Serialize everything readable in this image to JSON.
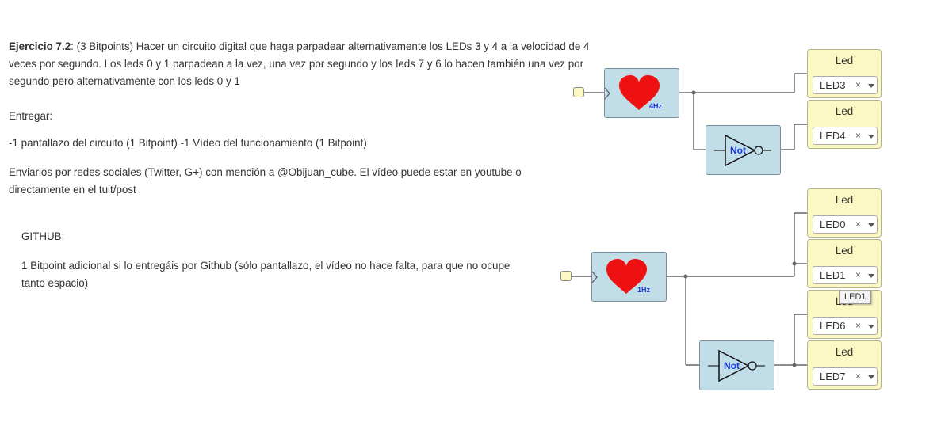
{
  "exercise": {
    "title": "Ejercicio 7.2",
    "intro": ": (3 Bitpoints) Hacer un circuito digital que haga parpadear alternativamente los LEDs 3 y 4 a la velocidad de 4 veces por segundo. Los leds 0 y 1 parpadean a la vez, una vez por segundo y los leds 7 y 6 lo hacen también una vez por segundo pero alternativamente con los leds 0 y 1",
    "entregar": "Entregar:",
    "items": "-1 pantallazo del circuito (1 Bitpoint) -1 Vídeo del funcionamiento (1 Bitpoint)",
    "enviar": "Enviarlos por redes sociales (Twitter, G+) con mención a @Obijuan_cube. El vídeo puede estar en youtube o directamente en el tuit/post",
    "github_title": "GITHUB:",
    "github_body": "1 Bitpoint adicional si lo entregáis por Github (sólo pantallazo, el vídeo no hace falta, para que no ocupe tanto espacio)"
  },
  "circuit": {
    "top": {
      "clock_freq": "4Hz",
      "not_label": "Not",
      "leds": [
        {
          "title": "Led",
          "value": "LED3",
          "clear": "×"
        },
        {
          "title": "Led",
          "value": "LED4",
          "clear": "×"
        }
      ]
    },
    "bottom": {
      "clock_freq": "1Hz",
      "not_label": "Not",
      "leds": [
        {
          "title": "Led",
          "value": "LED0",
          "clear": "×"
        },
        {
          "title": "Led",
          "value": "LED1",
          "clear": "×"
        },
        {
          "title": "Led",
          "value": "LED6",
          "clear": "×"
        },
        {
          "title": "Led",
          "value": "LED7",
          "clear": "×"
        }
      ]
    },
    "tooltip": "LED1",
    "colors": {
      "block_bg": "#c1dde8",
      "led_bg": "#fbf8c4",
      "heart": "#ee1111",
      "label_blue": "#1a3bd6",
      "wire": "#666666"
    }
  }
}
